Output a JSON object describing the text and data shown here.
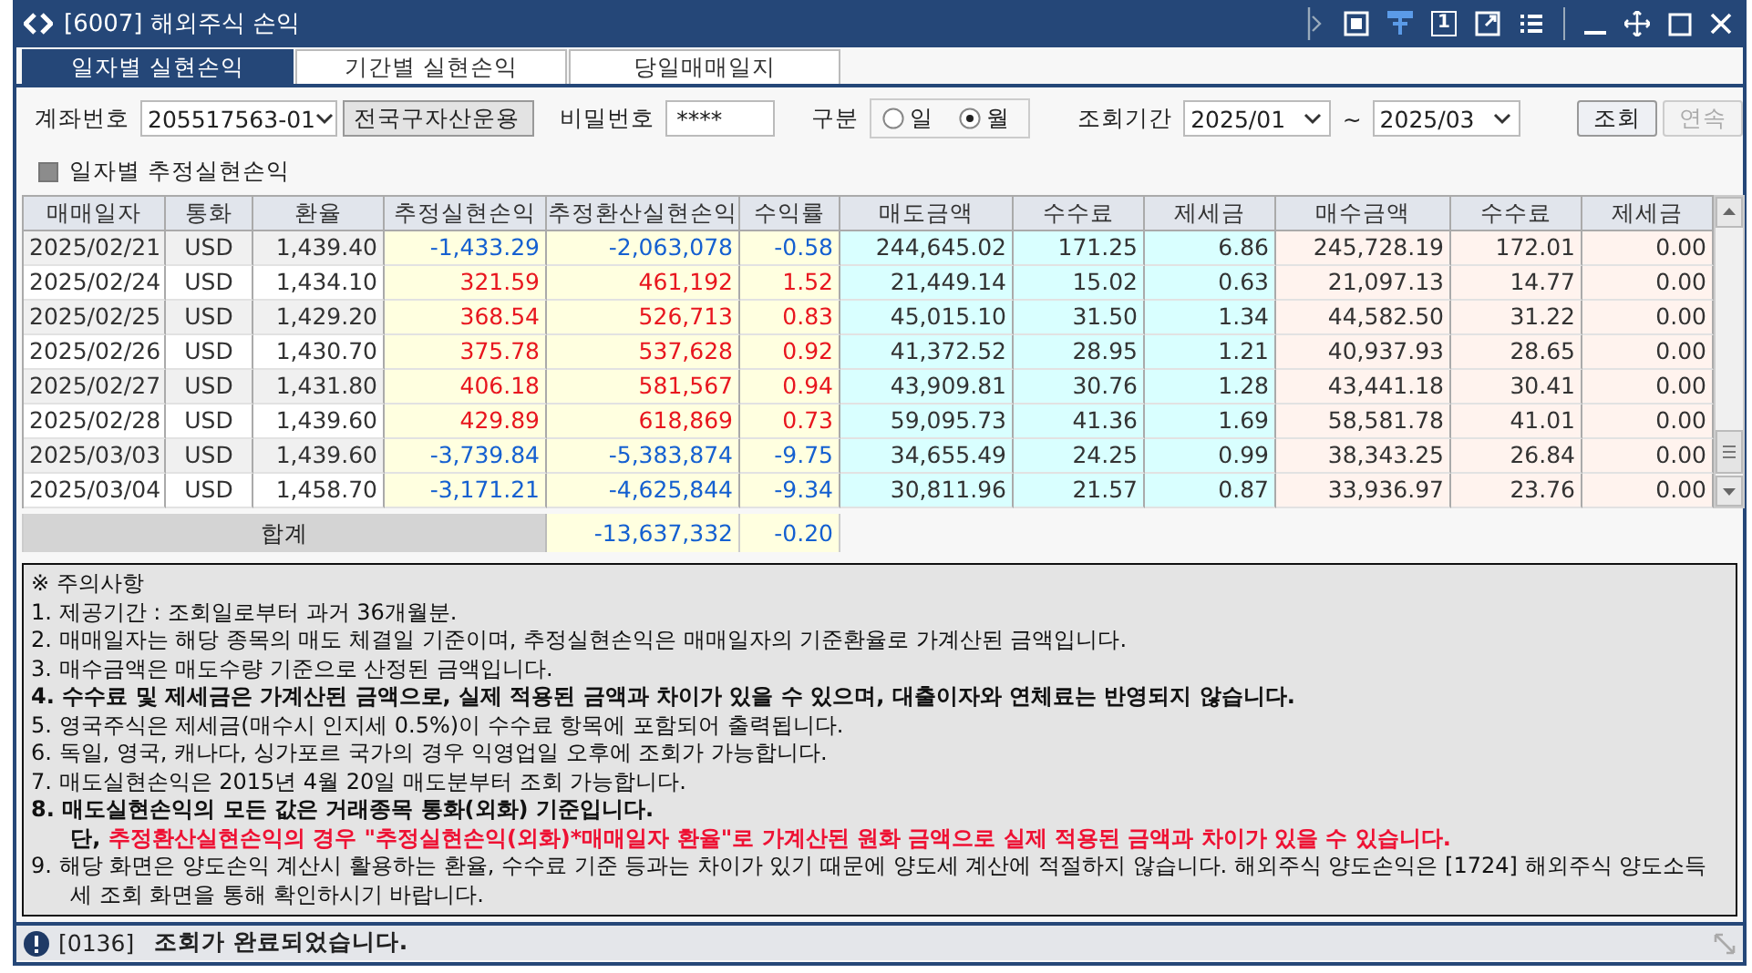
{
  "window": {
    "title": "[6007] 해외주식 손익",
    "toolbar_badge": "1"
  },
  "tabs": [
    {
      "label": "일자별 실현손익",
      "selected": true
    },
    {
      "label": "기간별 실현손익",
      "selected": false
    },
    {
      "label": "당일매매일지",
      "selected": false
    }
  ],
  "form": {
    "account_label": "계좌번호",
    "account": "205517563-01",
    "account_name": "전국구자산운용",
    "password_label": "비밀번호",
    "password": "****",
    "type_label": "구분",
    "type_options": [
      {
        "label": "일",
        "selected": false
      },
      {
        "label": "월",
        "selected": true
      }
    ],
    "period_label": "조회기간",
    "period_from": "2025/01",
    "period_sep": "~",
    "period_to": "2025/03",
    "buttons": [
      {
        "label": "조회",
        "disabled": false
      },
      {
        "label": "연속",
        "disabled": true
      }
    ],
    "estimate_checkbox": {
      "label": "일자별 추정실현손익",
      "checked": true
    }
  },
  "table": {
    "columns": [
      "매매일자",
      "통화",
      "환율",
      "추정실현손익",
      "추정환산실현손익",
      "수익률",
      "매도금액",
      "수수료",
      "제세금",
      "매수금액",
      "수수료",
      "제세금"
    ],
    "rows": [
      {
        "color": "#1560d0",
        "cells": [
          "2025/02/21",
          "USD",
          "1,439.40",
          "-1,433.29",
          "-2,063,078",
          "-0.58",
          "244,645.02",
          "171.25",
          "6.86",
          "245,728.19",
          "172.01",
          "0.00"
        ]
      },
      {
        "color": "#e8161e",
        "cells": [
          "2025/02/24",
          "USD",
          "1,434.10",
          "321.59",
          "461,192",
          "1.52",
          "21,449.14",
          "15.02",
          "0.63",
          "21,097.13",
          "14.77",
          "0.00"
        ]
      },
      {
        "color": "#e8161e",
        "cells": [
          "2025/02/25",
          "USD",
          "1,429.20",
          "368.54",
          "526,713",
          "0.83",
          "45,015.10",
          "31.50",
          "1.34",
          "44,582.50",
          "31.22",
          "0.00"
        ]
      },
      {
        "color": "#e8161e",
        "cells": [
          "2025/02/26",
          "USD",
          "1,430.70",
          "375.78",
          "537,628",
          "0.92",
          "41,372.52",
          "28.95",
          "1.21",
          "40,937.93",
          "28.65",
          "0.00"
        ]
      },
      {
        "color": "#e8161e",
        "cells": [
          "2025/02/27",
          "USD",
          "1,431.80",
          "406.18",
          "581,567",
          "0.94",
          "43,909.81",
          "30.76",
          "1.28",
          "43,441.18",
          "30.41",
          "0.00"
        ]
      },
      {
        "color": "#e8161e",
        "cells": [
          "2025/02/28",
          "USD",
          "1,439.60",
          "429.89",
          "618,869",
          "0.73",
          "59,095.73",
          "41.36",
          "1.69",
          "58,581.78",
          "41.01",
          "0.00"
        ]
      },
      {
        "color": "#1560d0",
        "cells": [
          "2025/03/03",
          "USD",
          "1,439.60",
          "-3,739.84",
          "-5,383,874",
          "-9.75",
          "34,655.49",
          "24.25",
          "0.99",
          "38,343.25",
          "26.84",
          "0.00"
        ]
      },
      {
        "color": "#1560d0",
        "cells": [
          "2025/03/04",
          "USD",
          "1,458.70",
          "-3,171.21",
          "-4,625,844",
          "-9.34",
          "30,811.96",
          "21.57",
          "0.87",
          "33,936.97",
          "23.76",
          "0.00"
        ]
      }
    ],
    "total": {
      "label": "합계",
      "color": "#1560d0",
      "converted": "-13,637,332",
      "rate": "-0.20"
    }
  },
  "notes": {
    "title": "※ 주의사항",
    "items": [
      {
        "kind": "plain",
        "text": "1. 제공기간 : 조회일로부터 과거 36개월분."
      },
      {
        "kind": "plain",
        "text": "2. 매매일자는 해당 종목의 매도 체결일 기준이며, 추정실현손익은 매매일자의 기준환율로 가계산된 금액입니다."
      },
      {
        "kind": "plain",
        "text": "3. 매수금액은 매도수량 기준으로 산정된 금액입니다."
      },
      {
        "kind": "bold",
        "text": "4. 수수료 및 제세금은 가계산된 금액으로, 실제 적용된 금액과 차이가 있을 수 있으며, 대출이자와 연체료는 반영되지 않습니다."
      },
      {
        "kind": "plain",
        "text": "5. 영국주식은 제세금(매수시 인지세 0.5%)이 수수료 항목에 포함되어 출력됩니다."
      },
      {
        "kind": "plain",
        "text": "6. 독일, 영국, 캐나다, 싱가포르 국가의 경우 익영업일 오후에 조회가 가능합니다."
      },
      {
        "kind": "plain",
        "text": "7. 매도실현손익은 2015년 4월 20일 매도분부터 조회 가능합니다."
      },
      {
        "kind": "bold",
        "text": "8. 매도실현손익의 모든 값은 거래종목 통화(외화) 기준입니다."
      },
      {
        "kind": "warning",
        "prefix": "단, ",
        "text": "추정환산실현손익의 경우 \"추정실현손익(외화)*매매일자 환율\"로 가계산된 원화 금액으로 실제 적용된 금액과 차이가 있을 수 있습니다."
      },
      {
        "kind": "plain",
        "text": "9. 해당 화면은 양도손익 계산시 활용하는 환율, 수수료 기준 등과는 차이가 있기 때문에 양도세 계산에 적절하지 않습니다. 해외주식 양도손익은 [1724] 해외주식 양도소득세 조회 화면을 통해 확인하시기 바랍니다."
      }
    ]
  },
  "status_bar": {
    "code": "[0136]",
    "message": "조회가 완료되었습니다."
  }
}
